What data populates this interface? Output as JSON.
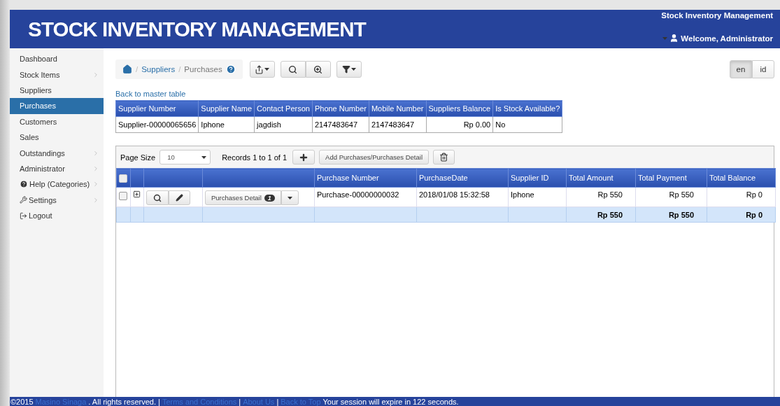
{
  "header": {
    "title": "STOCK INVENTORY MANAGEMENT",
    "app_name": "Stock Inventory Management",
    "welcome": "Welcome, Administrator"
  },
  "sidebar": {
    "items": [
      {
        "label": "Dashboard",
        "kind": "plain",
        "selected": false,
        "has_submenu": false
      },
      {
        "label": "Stock Items",
        "kind": "plain",
        "selected": false,
        "has_submenu": true
      },
      {
        "label": "Suppliers",
        "kind": "plain",
        "selected": false,
        "has_submenu": false
      },
      {
        "label": "Purchases",
        "kind": "plain",
        "selected": true,
        "has_submenu": false
      },
      {
        "label": "Customers",
        "kind": "plain",
        "selected": false,
        "has_submenu": false
      },
      {
        "label": "Sales",
        "kind": "plain",
        "selected": false,
        "has_submenu": false
      },
      {
        "label": "Outstandings",
        "kind": "plain",
        "selected": false,
        "has_submenu": true
      },
      {
        "label": "Administrator",
        "kind": "plain",
        "selected": false,
        "has_submenu": true
      },
      {
        "label": "Help (Categories)",
        "kind": "help",
        "selected": false,
        "has_submenu": true
      },
      {
        "label": "Settings",
        "kind": "settings",
        "selected": false,
        "has_submenu": true
      },
      {
        "label": "Logout",
        "kind": "logout",
        "selected": false,
        "has_submenu": false
      }
    ]
  },
  "breadcrumb": {
    "separator": "/",
    "links": [
      "Suppliers"
    ],
    "current": "Purchases"
  },
  "languages": [
    {
      "label": "en",
      "selected": true
    },
    {
      "label": "id",
      "selected": false
    }
  ],
  "back_link": "Back to master table",
  "master_table": {
    "columns": [
      "Supplier Number",
      "Supplier Name",
      "Contact Person",
      "Phone Number",
      "Mobile Number",
      "Suppliers Balance",
      "Is Stock Available?"
    ],
    "rows": [
      [
        "Supplier-00000065656",
        "Iphone",
        "jagdish",
        "2147483647",
        "2147483647",
        "Rp 0.00",
        "No"
      ]
    ]
  },
  "grid": {
    "page_size_label": "Page Size",
    "page_size": "10",
    "records": "Records 1 to 1 of 1",
    "add_detail_button": "Add Purchases/Purchases Detail",
    "columns": [
      "Purchase Number",
      "PurchaseDate",
      "Supplier ID",
      "Total Amount",
      "Total Payment",
      "Total Balance"
    ],
    "rows": [
      {
        "checked": false,
        "detail_button": "Purchases Detail",
        "detail_count": "1",
        "cells": [
          "Purchase-00000000032",
          "2018/01/08 15:32:58",
          "Iphone",
          "Rp 550",
          "Rp 550",
          "Rp 0"
        ]
      }
    ],
    "select_all_checked": false,
    "totals": [
      "Rp 550",
      "Rp 550",
      "Rp 0"
    ]
  },
  "footer": [
    {
      "kind": "text",
      "text": "©2015"
    },
    {
      "kind": "link",
      "text": "Masino Sinaga"
    },
    {
      "kind": "text",
      "text": ". All rights reserved. |"
    },
    {
      "kind": "link",
      "text": "Terms and Conditions"
    },
    {
      "kind": "text",
      "text": "|"
    },
    {
      "kind": "link",
      "text": "About Us"
    },
    {
      "kind": "text",
      "text": "|"
    },
    {
      "kind": "link",
      "text": "Back to Top"
    },
    {
      "kind": "text",
      "text": "Your session will expire in 122 seconds."
    }
  ]
}
